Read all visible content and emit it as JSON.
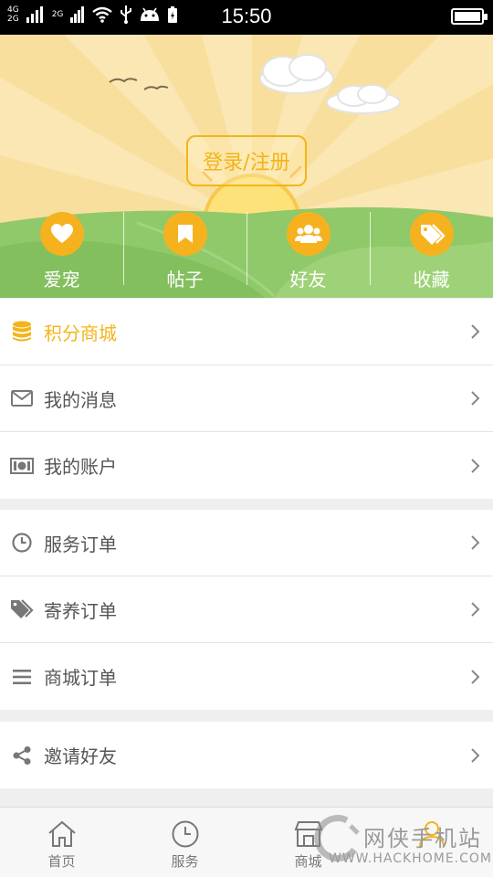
{
  "status_bar": {
    "network_top": "4G",
    "network_bottom": "2G",
    "network2": "2G",
    "time": "15:50",
    "battery_level": 1.0
  },
  "header": {
    "login_label": "登录/注册",
    "quick_links": [
      {
        "label": "爱宠",
        "icon": "heart-icon"
      },
      {
        "label": "帖子",
        "icon": "bookmark-icon"
      },
      {
        "label": "好友",
        "icon": "friends-icon"
      },
      {
        "label": "收藏",
        "icon": "tags-icon"
      }
    ]
  },
  "menu": {
    "group1": [
      {
        "label": "积分商城",
        "icon": "coins-icon",
        "highlight": true
      },
      {
        "label": "我的消息",
        "icon": "envelope-icon"
      },
      {
        "label": "我的账户",
        "icon": "money-icon"
      }
    ],
    "group2": [
      {
        "label": "服务订单",
        "icon": "clock-icon"
      },
      {
        "label": "寄养订单",
        "icon": "tags-icon"
      },
      {
        "label": "商城订单",
        "icon": "list-icon"
      }
    ],
    "group3": [
      {
        "label": "邀请好友",
        "icon": "share-icon"
      }
    ]
  },
  "tabbar": {
    "tabs": [
      {
        "label": "首页",
        "icon": "home-icon"
      },
      {
        "label": "服务",
        "icon": "clock-icon"
      },
      {
        "label": "商城",
        "icon": "store-icon"
      },
      {
        "label": "",
        "icon": "user-icon"
      }
    ]
  },
  "watermark": {
    "text": "网侠手机站",
    "url": "WWW.HACKHOME.COM"
  },
  "colors": {
    "accent": "#f6b21e",
    "text": "#555555",
    "divider": "#e2e2e2",
    "background": "#efefef"
  }
}
